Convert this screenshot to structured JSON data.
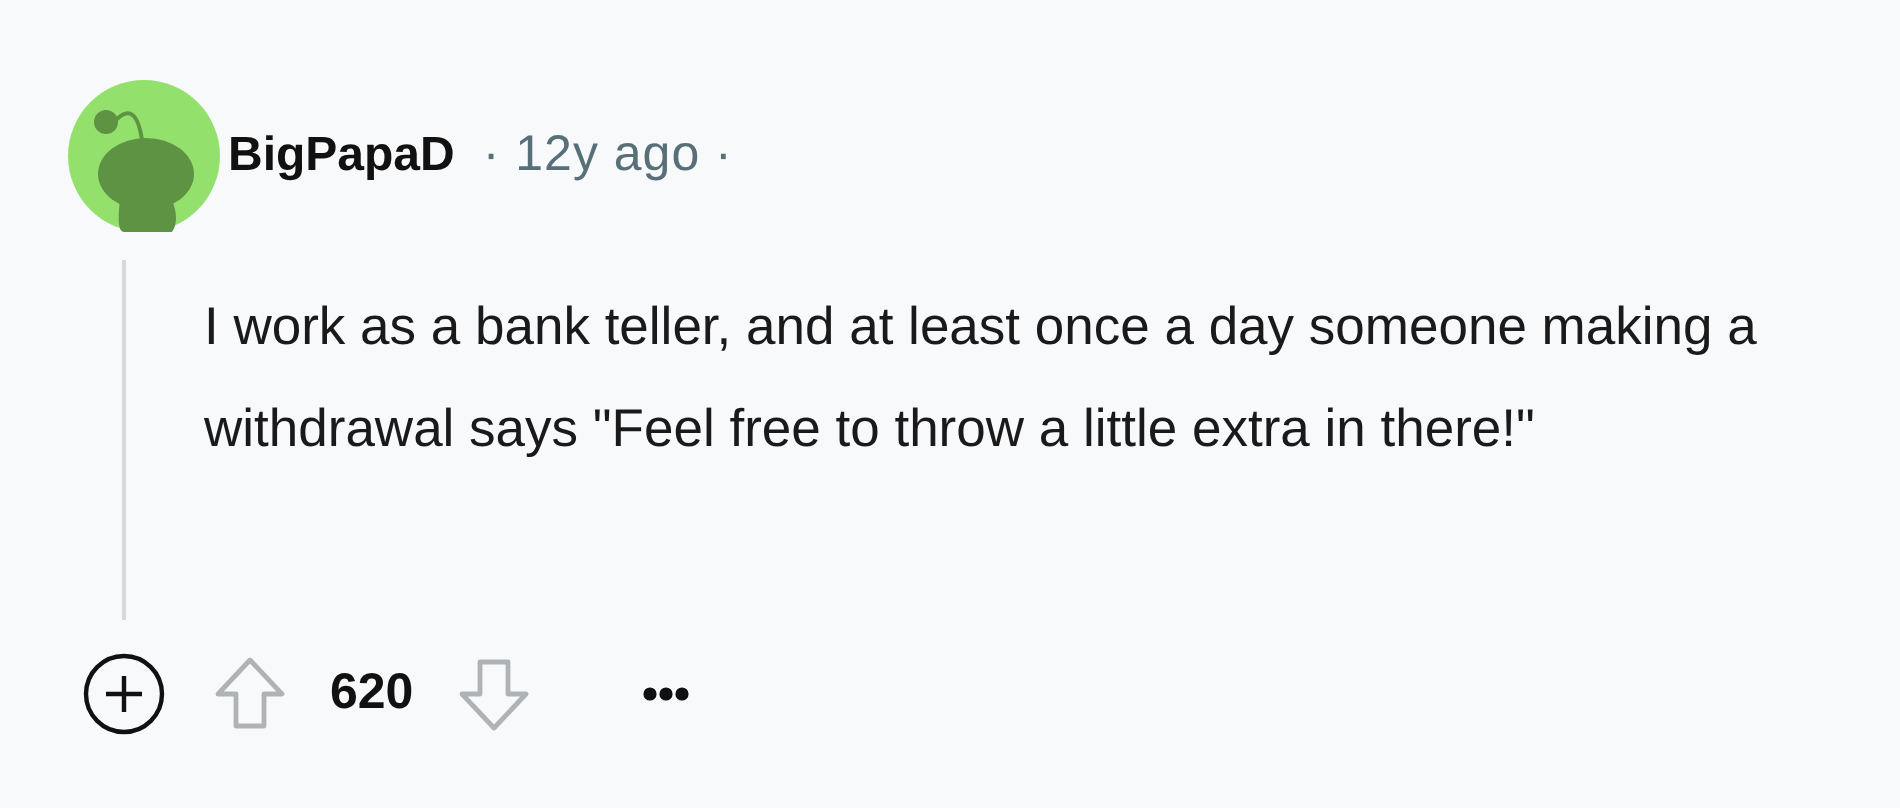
{
  "comment": {
    "author": "BigPapaD",
    "meta": "· 12y ago ·",
    "body": "I work as a bank teller, and at least once a day someone making a withdrawal says \"Feel free to throw a little extra in there!\"",
    "score": "620"
  }
}
